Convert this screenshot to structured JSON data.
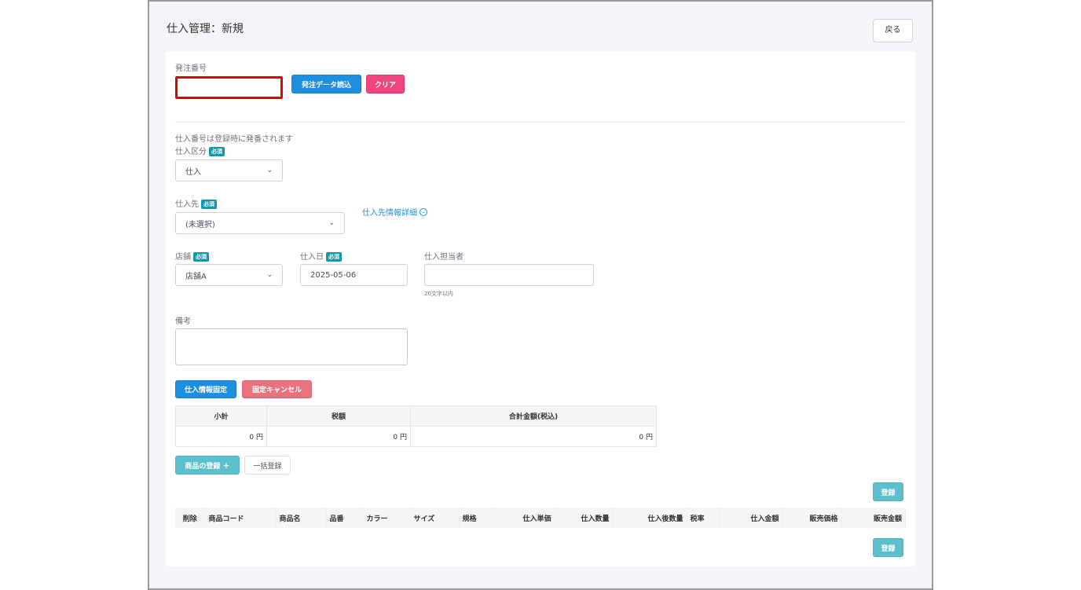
{
  "page": {
    "title": "仕入管理：新規",
    "back_label": "戻る"
  },
  "order": {
    "label": "発注番号",
    "value": "",
    "load_label": "発注データ読込",
    "clear_label": "クリア"
  },
  "form": {
    "note": "仕入番号は登録時に発番されます",
    "required_badge": "必須",
    "category": {
      "label": "仕入区分",
      "value": "仕入"
    },
    "supplier": {
      "label": "仕入先",
      "value": "(未選択)",
      "detail_link": "仕入先情報詳細"
    },
    "store": {
      "label": "店舗",
      "value": "店舗A"
    },
    "date": {
      "label": "仕入日",
      "value": "2025-05-06"
    },
    "staff": {
      "label": "仕入担当者",
      "value": "",
      "hint": "20文字以内"
    },
    "remarks": {
      "label": "備考",
      "value": ""
    },
    "fix_label": "仕入情報固定",
    "cancel_fix_label": "固定キャンセル"
  },
  "summary": {
    "headers": [
      "小計",
      "税額",
      "合計金額(税込)"
    ],
    "values": [
      "0 円",
      "0 円",
      "0 円"
    ]
  },
  "items": {
    "add_label": "商品の登録 ＋",
    "bulk_label": "一括登録",
    "register_label": "登録",
    "columns": [
      "削除",
      "商品コード",
      "商品名",
      "品番",
      "カラー",
      "サイズ",
      "規格",
      "仕入単価",
      "仕入数量",
      "仕入後数量",
      "税率",
      "仕入金額",
      "販売価格",
      "販売金額"
    ]
  },
  "colors": {
    "primary": "#1e8fe0",
    "danger": "#f0457f",
    "badge": "#1597a8",
    "teal": "#5bc0cc",
    "highlight": "#e00000"
  }
}
